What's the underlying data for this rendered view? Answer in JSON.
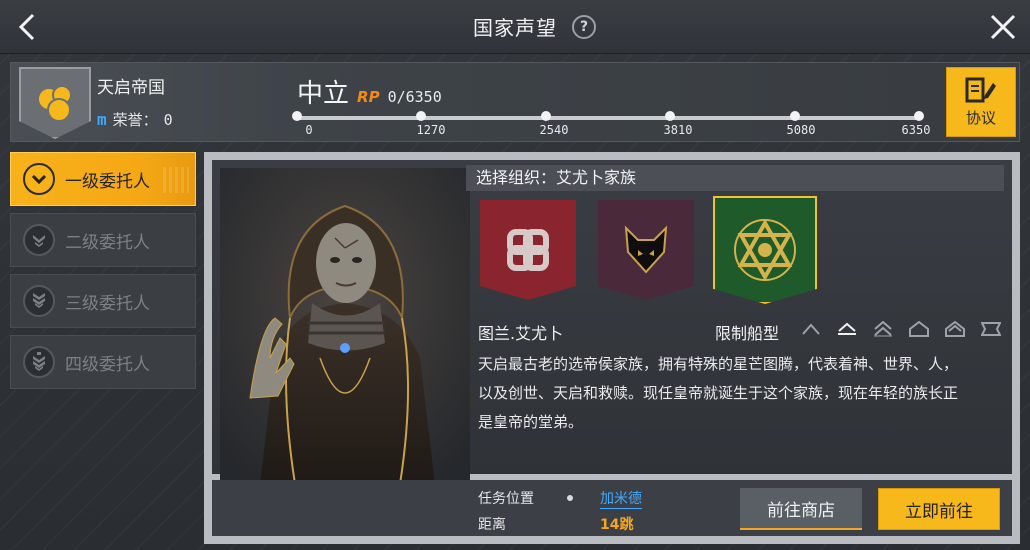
{
  "window": {
    "title": "国家声望",
    "help_glyph": "?"
  },
  "header": {
    "faction_name": "天启帝国",
    "honor_badge": "m",
    "honor_label": "荣誉：",
    "honor_value": "0",
    "reputation_name": "中立",
    "rp_label": "RP",
    "rp_value": "0/6350",
    "rp_progress_fraction": 0,
    "ticks": [
      "0",
      "1270",
      "2540",
      "3810",
      "5080",
      "6350"
    ],
    "agreement_label": "协议"
  },
  "sidebar": {
    "tabs": [
      {
        "label": "一级委托人",
        "active": true
      },
      {
        "label": "二级委托人",
        "active": false
      },
      {
        "label": "三级委托人",
        "active": false
      },
      {
        "label": "四级委托人",
        "active": false
      }
    ]
  },
  "main": {
    "org_header": "选择组织：艾尤卜家族",
    "banners": [
      {
        "icon": "knot-emblem-icon",
        "color": "#8a2530",
        "selected": false
      },
      {
        "icon": "wolf-emblem-icon",
        "color": "#4a2a3a",
        "selected": false
      },
      {
        "icon": "star-of-david-emblem-icon",
        "color": "#1f5a2a",
        "selected": true
      }
    ],
    "leader_name": "图兰.艾尤卜",
    "ship_limit_label": "限制船型",
    "ship_icons": [
      "ship-class-1-icon",
      "ship-class-2-icon",
      "ship-class-3-icon",
      "ship-class-4-icon",
      "ship-class-5-icon",
      "ship-class-6-icon"
    ],
    "description_lines": [
      "天启最古老的选帝侯家族，拥有特殊的星芒图腾，代表着神、世界、人，",
      "以及创世、天启和救赎。现任皇帝就诞生于这个家族，现在年轻的族长正",
      "是皇帝的堂弟。"
    ]
  },
  "footer": {
    "mission_label": "任务位置",
    "mission_value": "加米德",
    "distance_label": "距离",
    "distance_value": "14跳",
    "shop_button": "前往商店",
    "go_button": "立即前往"
  },
  "colors": {
    "accent": "#f6b81a",
    "rp": "#f28a1a",
    "link": "#3fa9ff"
  }
}
